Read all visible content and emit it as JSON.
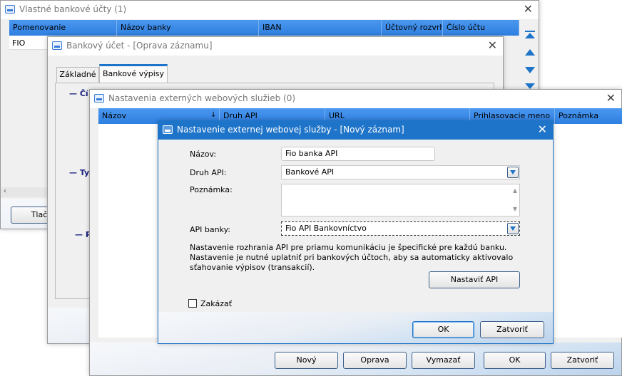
{
  "win1": {
    "title": "Vlastné bankové účty (1)",
    "columns": [
      "Pomenovanie",
      "Názov banky",
      "IBAN",
      "Účtovný rozvrh",
      "Číslo účtu"
    ],
    "row1_name": "FIO",
    "button_partial": "Tlač"
  },
  "win2": {
    "title": "Bankový účet - [Oprava záznamu]",
    "tabs": [
      "Základné",
      "Bankové výpisy"
    ],
    "section1_partial": "— Čí",
    "section2_partial": "— Ty",
    "section3_partial": "— P"
  },
  "win3": {
    "title": "Nastavenia externých webových služieb (0)",
    "columns": [
      "Názov",
      "Druh API",
      "URL",
      "Prihlasovacie meno",
      "Poznámka"
    ],
    "buttons": {
      "new": "Nový",
      "edit": "Oprava",
      "delete": "Vymazať",
      "ok": "OK",
      "close": "Zatvoriť"
    }
  },
  "dialog": {
    "title": "Nastavenie externej webovej služby - [Nový záznam]",
    "name_label": "Názov:",
    "name_value": "Fio banka API",
    "api_type_label": "Druh API:",
    "api_type_value": "Bankové API",
    "note_label": "Poznámka:",
    "note_value": "",
    "bank_api_label": "API banky:",
    "bank_api_value": "Fio API Bankovníctvo",
    "info_text": "Nastavenie rozhrania API pre priamu komunikáciu je špecifické pre každú banku.\nNastavenie je nutné uplatniť pri bankových účtoch, aby sa automaticky aktivovalo\nsťahovanie výpisov (transakcií).",
    "set_api_button": "Nastaviť API",
    "disable_label": "Zakázať",
    "ok_button": "OK",
    "close_button": "Zatvoriť"
  },
  "colors": {
    "accent": "#1e74c8",
    "header": "#3d8ae8",
    "label_blue": "#1a237e"
  },
  "icons": [
    "window-icon",
    "close-icon",
    "sort-icon",
    "chevron-down-icon",
    "arrow-top-icon",
    "arrow-up-icon",
    "arrow-down-icon"
  ]
}
